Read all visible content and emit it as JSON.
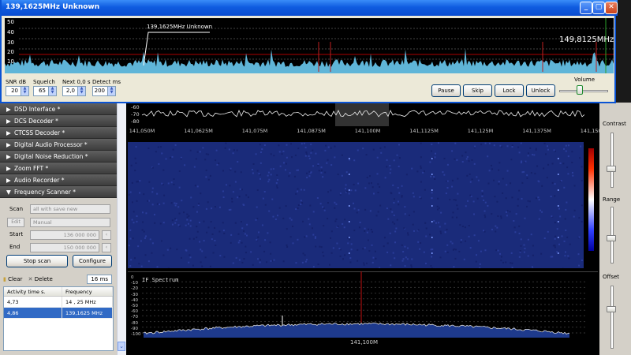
{
  "popup": {
    "title": "139,1625MHz Unknown",
    "plot_y_labels": [
      "50",
      "40",
      "30",
      "20",
      "10"
    ],
    "signal_annotation": "139,1625MHz Unknown",
    "current_freq": "149,8125MHz",
    "controls": {
      "snr": {
        "label": "SNR dB",
        "value": "20"
      },
      "squelch": {
        "label": "Squelch",
        "value": "65"
      },
      "next": {
        "label": "Next 0,0 s",
        "value": "2,0"
      },
      "detect": {
        "label": "Detect ms",
        "value": "200"
      }
    },
    "buttons": {
      "pause": "Pause",
      "skip": "Skip",
      "lock": "Lock",
      "unlock": "Unlock"
    },
    "volume_label": "Volume",
    "volume_level": 0.4
  },
  "plugins": [
    {
      "arrow": "▶",
      "label": "DSD Interface *"
    },
    {
      "arrow": "▶",
      "label": "DCS Decoder *"
    },
    {
      "arrow": "▶",
      "label": "CTCSS Decoder *"
    },
    {
      "arrow": "▶",
      "label": "Digital Audio Processor *"
    },
    {
      "arrow": "▶",
      "label": "Digital Noise Reduction *"
    },
    {
      "arrow": "▶",
      "label": "Zoom FFT *"
    },
    {
      "arrow": "▶",
      "label": "Audio Recorder *"
    },
    {
      "arrow": "▼",
      "label": "Frequency Scanner *"
    }
  ],
  "scanner": {
    "scan_label": "Scan",
    "scan_value": "all with save new",
    "edit_label": "Edit",
    "edit_value": "Manual",
    "start_label": "Start",
    "start_value": "136 000 000",
    "end_label": "End",
    "end_value": "150 000 000",
    "stop_scan": "Stop scan",
    "configure": "Configure",
    "clear": "Clear",
    "delete": "Delete",
    "interval": "16 ms"
  },
  "activity_table": {
    "headers": [
      "Activity time s.",
      "Frequency"
    ],
    "rows": [
      {
        "time": "4,73",
        "freq": "14 , 25 MHz"
      },
      {
        "time": "4,86",
        "freq": "139,1625 MHz"
      }
    ]
  },
  "spectrum": {
    "db_labels": [
      "-60",
      "-70",
      "-80"
    ],
    "freq_ticks": [
      "141,050M",
      "141,0625M",
      "141,075M",
      "141,0875M",
      "141,100M",
      "141,1125M",
      "141,125M",
      "141,1375M",
      "141,150M"
    ],
    "if_title": "IF Spectrum",
    "if_center": "141,100M",
    "if_db_labels": [
      "0",
      "-10",
      "-20",
      "-30",
      "-40",
      "-50",
      "-60",
      "-70",
      "-80",
      "-90",
      "-100"
    ]
  },
  "right_panel": {
    "contrast": "Contrast",
    "range": "Range",
    "offset": "Offset"
  },
  "colors": {
    "titlebar": "#0f5ce0",
    "waterfall": "#1a2b7a",
    "spectrum_trace": "#6fc6e6",
    "selected_row": "#316ac5"
  }
}
